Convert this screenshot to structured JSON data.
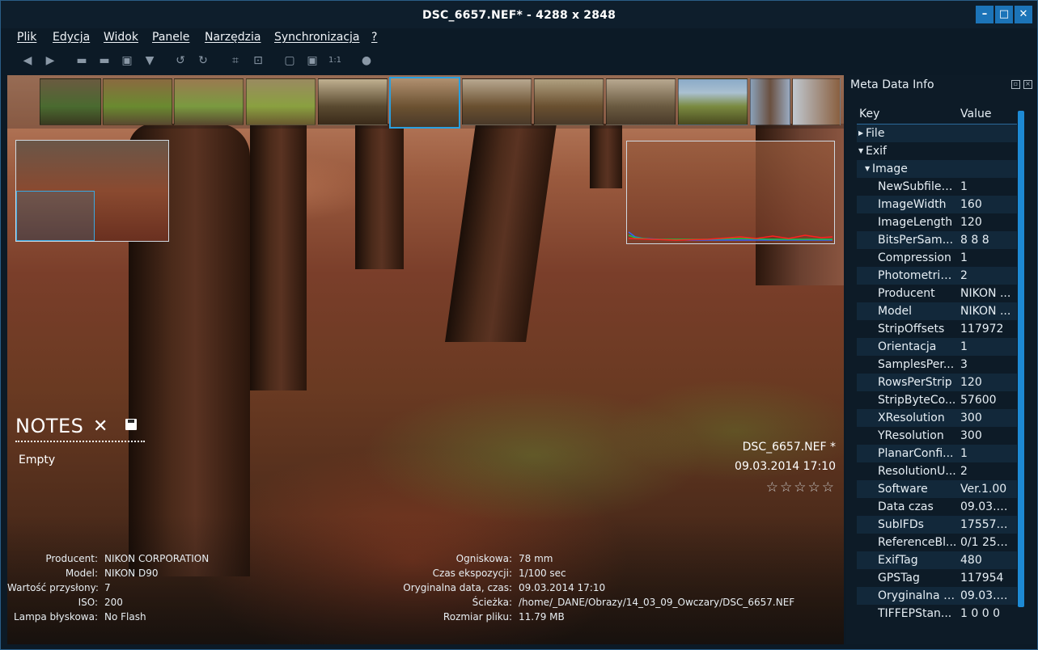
{
  "window": {
    "title": "DSC_6657.NEF*  - 4288 x 2848",
    "min_glyph": "–",
    "max_glyph": "□",
    "close_glyph": "✕"
  },
  "menu": [
    "Plik",
    "Edycja",
    "Widok",
    "Panele",
    "Narzędzia",
    "Synchronizacja",
    "?"
  ],
  "toolbar_icons": [
    "back-icon",
    "forward-icon",
    "open-folder-icon",
    "folder-icon",
    "save-icon",
    "filter-icon",
    "rotate-left-icon",
    "rotate-right-icon",
    "crop-icon",
    "zoom-region-icon",
    "fit-icon",
    "fullscreen-icon",
    "actual-size-icon",
    "globe-icon"
  ],
  "notes": {
    "title": "NOTES",
    "close_glyph": "✕",
    "body": "Empty"
  },
  "file_overlay": {
    "filename": "DSC_6657.NEF *",
    "date": "09.03.2014 17:10",
    "stars": "☆☆☆☆☆"
  },
  "exif_left": [
    {
      "k": "Producent:",
      "v": "NIKON CORPORATION"
    },
    {
      "k": "Model:",
      "v": "NIKON D90"
    },
    {
      "k": "Wartość przysłony:",
      "v": "7"
    },
    {
      "k": "ISO:",
      "v": "200"
    },
    {
      "k": "Lampa błyskowa:",
      "v": "No Flash"
    }
  ],
  "exif_right": [
    {
      "k": "Ogniskowa:",
      "v": "78 mm"
    },
    {
      "k": "Czas ekspozycji:",
      "v": "1/100 sec"
    },
    {
      "k": "Oryginalna data, czas:",
      "v": "09.03.2014 17:10"
    },
    {
      "k": "Ścieżka:",
      "v": "/home/_DANE/Obrazy/14_03_09_Owczary/DSC_6657.NEF"
    },
    {
      "k": "Rozmiar pliku:",
      "v": "11.79 MB"
    }
  ],
  "panel": {
    "title": "Meta Data Info",
    "col_key": "Key",
    "col_value": "Value",
    "rows": [
      {
        "k": "File",
        "v": "",
        "level": 0,
        "toggle": "▶"
      },
      {
        "k": "Exif",
        "v": "",
        "level": 0,
        "toggle": "▼"
      },
      {
        "k": "Image",
        "v": "",
        "level": 1,
        "toggle": "▼"
      },
      {
        "k": "NewSubfileT...",
        "v": "1",
        "level": 2
      },
      {
        "k": "ImageWidth",
        "v": "160",
        "level": 2
      },
      {
        "k": "ImageLength",
        "v": "120",
        "level": 2
      },
      {
        "k": "BitsPerSam...",
        "v": "8 8 8",
        "level": 2
      },
      {
        "k": "Compression",
        "v": "1",
        "level": 2
      },
      {
        "k": "Photometric...",
        "v": "2",
        "level": 2
      },
      {
        "k": "Producent",
        "v": "NIKON ...",
        "level": 2
      },
      {
        "k": "Model",
        "v": "NIKON ...",
        "level": 2
      },
      {
        "k": "StripOffsets",
        "v": "117972",
        "level": 2
      },
      {
        "k": "Orientacja",
        "v": "1",
        "level": 2
      },
      {
        "k": "SamplesPer...",
        "v": "3",
        "level": 2
      },
      {
        "k": "RowsPerStrip",
        "v": "120",
        "level": 2
      },
      {
        "k": "StripByteCo...",
        "v": "57600",
        "level": 2
      },
      {
        "k": "XResolution",
        "v": "300",
        "level": 2
      },
      {
        "k": "YResolution",
        "v": "300",
        "level": 2
      },
      {
        "k": "PlanarConfi...",
        "v": "1",
        "level": 2
      },
      {
        "k": "ResolutionU...",
        "v": "2",
        "level": 2
      },
      {
        "k": "Software",
        "v": "Ver.1.00",
        "level": 2
      },
      {
        "k": "Data czas",
        "v": "09.03.2...",
        "level": 2
      },
      {
        "k": "SubIFDs",
        "v": "175572 ...",
        "level": 2
      },
      {
        "k": "ReferenceBl...",
        "v": "0/1 255...",
        "level": 2
      },
      {
        "k": "ExifTag",
        "v": "480",
        "level": 2
      },
      {
        "k": "GPSTag",
        "v": "117954",
        "level": 2
      },
      {
        "k": "Oryginalna d...",
        "v": "09.03.2...",
        "level": 2
      },
      {
        "k": "TIFFEPStan...",
        "v": "1 0 0 0",
        "level": 2
      }
    ]
  }
}
